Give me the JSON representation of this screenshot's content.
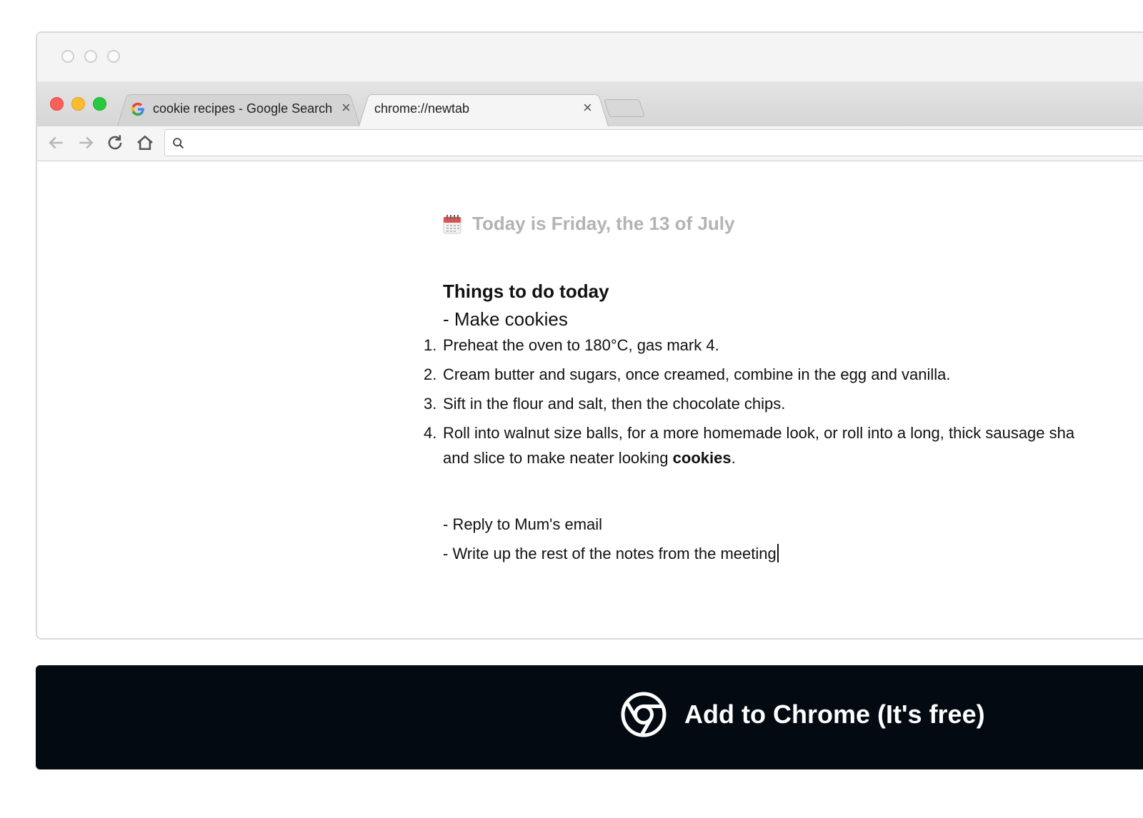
{
  "browser": {
    "tabs": [
      {
        "title": "cookie recipes - Google Search",
        "close": "×",
        "favicon": "google-icon"
      },
      {
        "title": "chrome://newtab",
        "close": "×",
        "favicon": ""
      }
    ],
    "toolbar": {
      "back_icon": "arrow-left-icon",
      "forward_icon": "arrow-right-icon",
      "reload_icon": "reload-icon",
      "home_icon": "home-icon",
      "search_icon": "search-icon",
      "omnibox_value": ""
    }
  },
  "page": {
    "date_icon": "calendar-icon",
    "date_text": "Today is Friday, the 13 of July",
    "heading": "Things to do today",
    "subheading": "- Make cookies",
    "steps": [
      {
        "num": "1.",
        "text": "Preheat the oven to 180°C, gas mark 4."
      },
      {
        "num": "2.",
        "text": "Cream butter and sugars, once creamed, combine in the egg and vanilla."
      },
      {
        "num": "3.",
        "text": "Sift in the flour and salt, then the chocolate chips."
      },
      {
        "num": "4.",
        "text": "Roll into walnut size balls, for a more homemade look, or roll into a long, thick sausage sha",
        "text_line2": "and slice to make neater looking ",
        "text_bold": "cookies",
        "text_end": "."
      }
    ],
    "tasks": [
      "- Reply to Mum's email",
      "- Write up the rest of the notes from the meeting"
    ]
  },
  "cta": {
    "icon": "chrome-icon",
    "label": "Add to Chrome (It's free)"
  },
  "colors": {
    "cta_background": "#030a12",
    "date_text": "#b3b3b3",
    "traffic_red": "#fc5f57",
    "traffic_yellow": "#fdbc2e",
    "traffic_green": "#28c840"
  }
}
